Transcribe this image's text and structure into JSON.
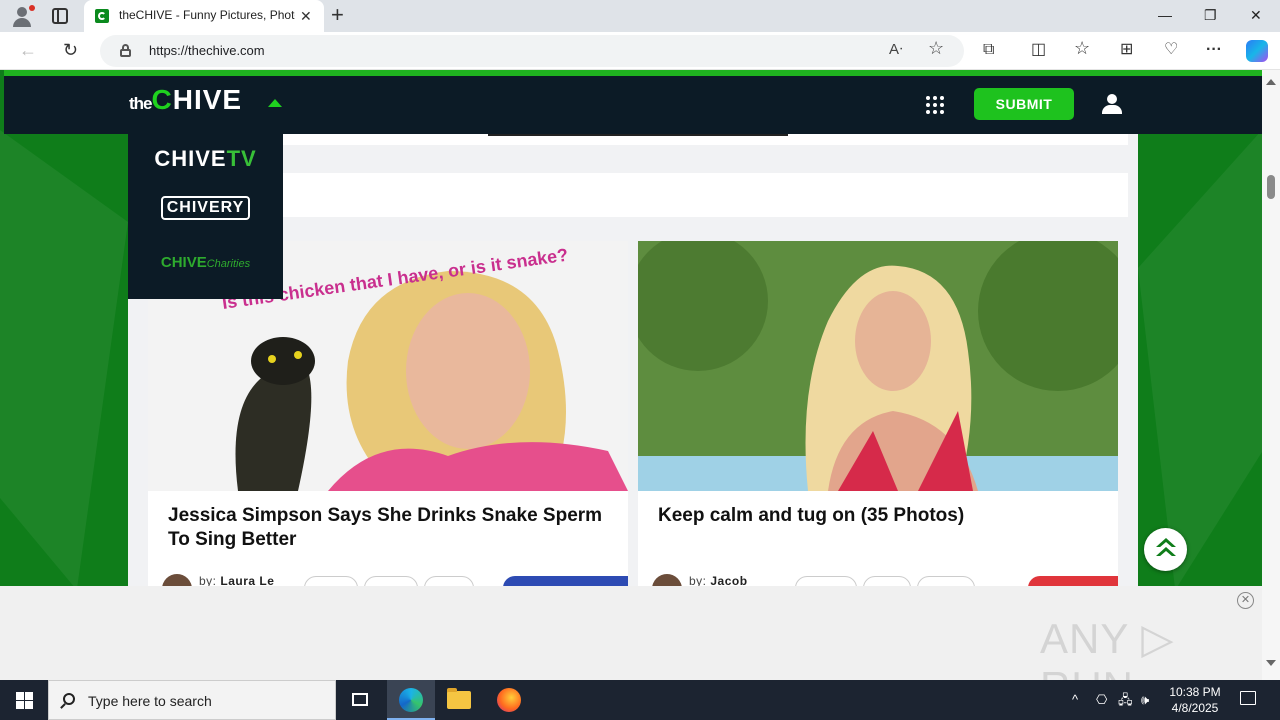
{
  "browser": {
    "tab_title": "theCHIVE - Funny Pictures, Photos, Memes & Videos",
    "tab_close": "✕",
    "new_tab": "+",
    "url": "https://thechive.com",
    "window_controls": {
      "minimize": "—",
      "restore": "❐",
      "close": "✕"
    },
    "nav": {
      "back": "←",
      "refresh": "↻"
    },
    "address_icons": {
      "read_aloud": "Aᐧ",
      "favorite": "☆"
    },
    "toolbar_icons": {
      "extensions": "⧉",
      "split": "◫",
      "favorites": "☆",
      "collections": "⊞",
      "performance": "♡",
      "more": "···"
    }
  },
  "site": {
    "logo_the": "the",
    "logo_c": "C",
    "logo_hive": "HIVE",
    "submit_label": "SUBMIT",
    "accent": "#1ec21e",
    "nav_bg": "#0c1b26",
    "dropdown": {
      "chive_tv_a": "CHIVE",
      "chive_tv_b": "TV",
      "chivery": "CHIVERY",
      "charities_a": "CHIVE",
      "charities_b": "Charities"
    },
    "cards": [
      {
        "title": "Jessica Simpson Says She Drinks Snake Sperm To Sing Better",
        "image_caption": "Is this chicken that I have, or is it snake?",
        "by_prefix": "by:",
        "author": "Laura Le",
        "button_color": "#2d4bb3"
      },
      {
        "title": "Keep calm and tug on (35 Photos)",
        "by_prefix": "by:",
        "author": "Jacob",
        "button_color": "#e0353b"
      }
    ]
  },
  "ad": {
    "close": "✕",
    "watermark": "ANY ▷ RUN"
  },
  "taskbar": {
    "search_placeholder": "Type here to search",
    "time": "10:38 PM",
    "date": "4/8/2025",
    "tray": {
      "chevron": "^",
      "network": "🖧",
      "volume": "🕪"
    }
  }
}
